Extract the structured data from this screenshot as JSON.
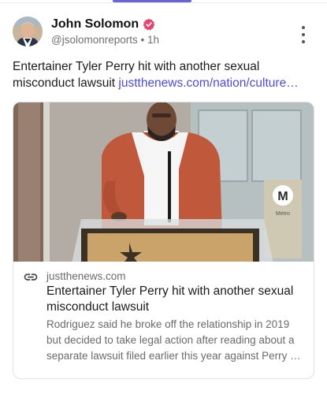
{
  "post": {
    "author_name": "John Solomon",
    "handle": "@jsolomonreports",
    "separator": " • ",
    "time": "1h",
    "text": "Entertainer Tyler Perry hit with another sexual misconduct lawsuit ",
    "link_text": "justthenews.com/nation/culture…"
  },
  "card": {
    "domain": "justthenews.com",
    "title": "Entertainer Tyler Perry hit with another sexual misconduct lawsuit",
    "description": "Rodriguez said he broke off the relationship in 2019 but decided to take legal action after reading about a separate lawsuit filed earlier this year against Perry by actor Derek Dixon. Perry's lawyers dispute the allegati…",
    "metro_sign": "M",
    "metro_sign_small": "Metro"
  },
  "colors": {
    "verified": "#e4446f",
    "link": "#4b4bd6",
    "indicator": "#6a63d9"
  },
  "icons": [
    "verified-badge-icon",
    "more-options-icon",
    "link-icon"
  ]
}
